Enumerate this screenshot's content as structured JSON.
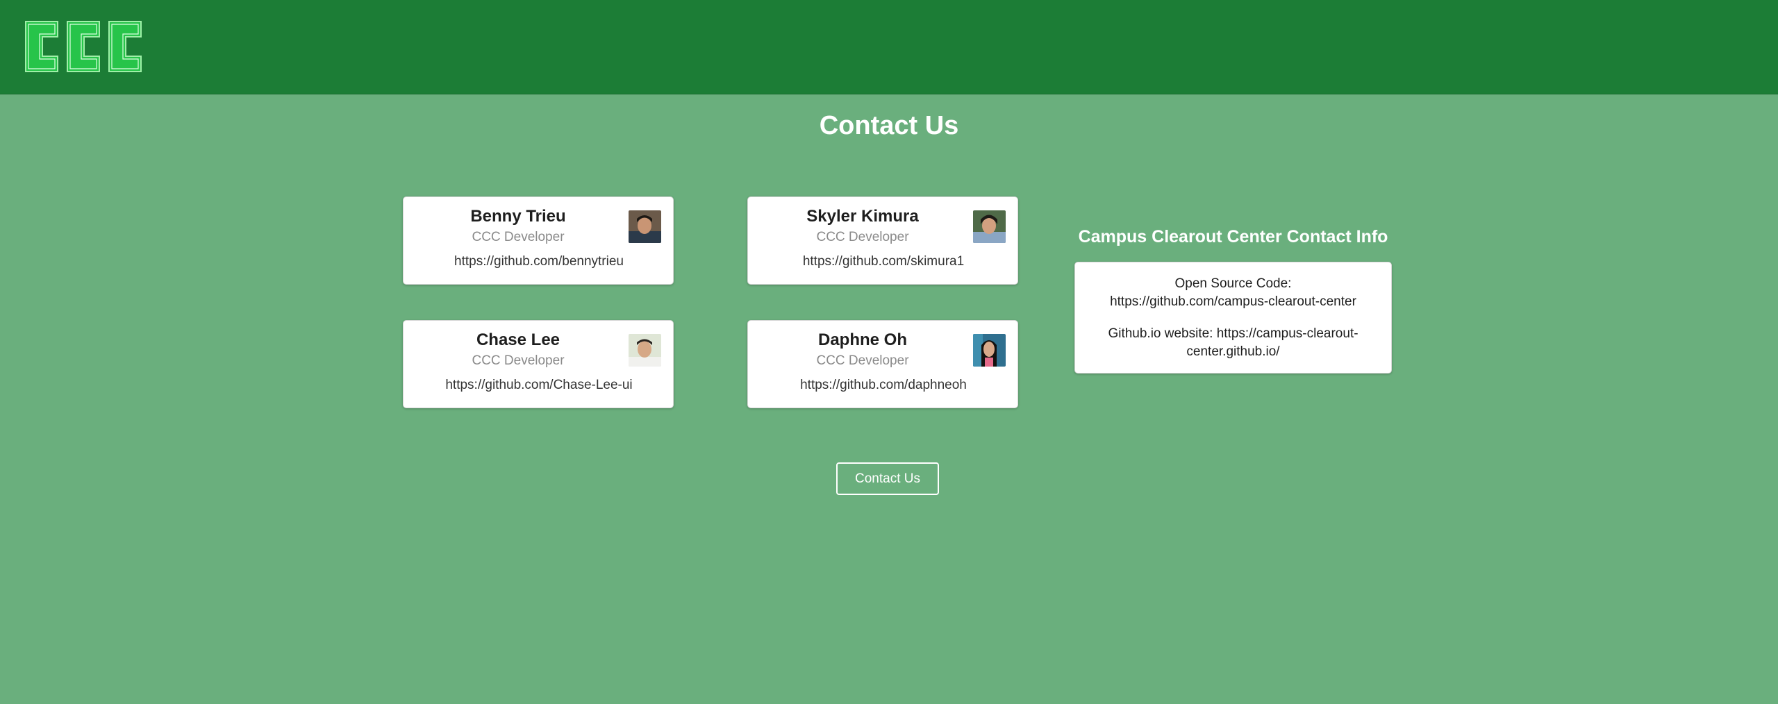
{
  "header": {
    "logo_text": "CCC"
  },
  "page_title": "Contact Us",
  "team": [
    {
      "name": "Benny Trieu",
      "role": "CCC Developer",
      "link": "https://github.com/bennytrieu",
      "avatar": "person-photo"
    },
    {
      "name": "Skyler Kimura",
      "role": "CCC Developer",
      "link": "https://github.com/skimura1",
      "avatar": "person-photo"
    },
    {
      "name": "Chase Lee",
      "role": "CCC Developer",
      "link": "https://github.com/Chase-Lee-ui",
      "avatar": "person-photo"
    },
    {
      "name": "Daphne Oh",
      "role": "CCC Developer",
      "link": "https://github.com/daphneoh",
      "avatar": "person-photo"
    }
  ],
  "contact_info": {
    "title": "Campus Clearout Center Contact Info",
    "lines": [
      "Open Source Code: https://github.com/campus-clearout-center",
      "Github.io website: https://campus-clearout-center.github.io/"
    ]
  },
  "contact_button_label": "Contact Us",
  "colors": {
    "header_bg": "#1c7d36",
    "page_bg": "#6aaf7d",
    "logo_green": "#2ecc4f"
  }
}
